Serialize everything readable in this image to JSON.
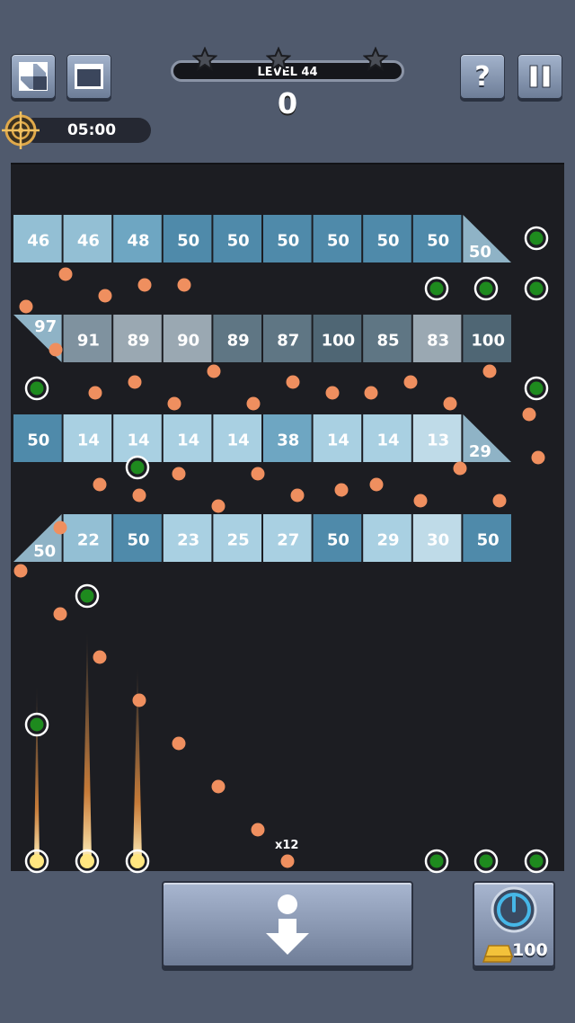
{
  "hud": {
    "level_label": "LEVEL 44",
    "score": "0",
    "timer": "05:00",
    "stars_total": 3,
    "stars_earned": 0
  },
  "buttons": {
    "help_label": "?",
    "pause_label": "II",
    "power_cost": "100"
  },
  "balls": {
    "multiplier_label": "x12"
  },
  "colors": {
    "background": "#505a6d",
    "board": "#1c1d22",
    "ball": "#ef8f5f",
    "pickup_ring": "#ffffff",
    "pickup_core": "#1e8a1e"
  },
  "bricks": {
    "row1": [
      {
        "value": "46",
        "shade": "light"
      },
      {
        "value": "46",
        "shade": "light"
      },
      {
        "value": "48",
        "shade": "medium"
      },
      {
        "value": "50",
        "shade": "dark"
      },
      {
        "value": "50",
        "shade": "dark"
      },
      {
        "value": "50",
        "shade": "dark"
      },
      {
        "value": "50",
        "shade": "dark"
      },
      {
        "value": "50",
        "shade": "dark"
      },
      {
        "value": "50",
        "shade": "dark"
      },
      {
        "value": "50",
        "shape": "triangle-bottom-left"
      }
    ],
    "row2": [
      {
        "value": "97",
        "shape": "triangle-top-right"
      },
      {
        "value": "91",
        "shade": "grey-medium"
      },
      {
        "value": "89",
        "shade": "grey-light"
      },
      {
        "value": "90",
        "shade": "grey-light"
      },
      {
        "value": "89",
        "shade": "grey-dark"
      },
      {
        "value": "87",
        "shade": "grey-dark"
      },
      {
        "value": "100",
        "shade": "grey-darker"
      },
      {
        "value": "85",
        "shade": "grey-dark"
      },
      {
        "value": "83",
        "shade": "grey-light"
      },
      {
        "value": "100",
        "shade": "grey-darker"
      }
    ],
    "row3": [
      {
        "value": "50",
        "shade": "dark"
      },
      {
        "value": "14",
        "shade": "pale"
      },
      {
        "value": "14",
        "shade": "pale"
      },
      {
        "value": "14",
        "shade": "pale"
      },
      {
        "value": "14",
        "shade": "pale"
      },
      {
        "value": "38",
        "shade": "medium"
      },
      {
        "value": "14",
        "shade": "pale"
      },
      {
        "value": "14",
        "shade": "pale"
      },
      {
        "value": "13",
        "shade": "palest"
      },
      {
        "value": "29",
        "shape": "triangle-bottom-left"
      }
    ],
    "row4": [
      {
        "value": "50",
        "shape": "triangle-bottom-right"
      },
      {
        "value": "22",
        "shade": "light"
      },
      {
        "value": "50",
        "shade": "dark"
      },
      {
        "value": "23",
        "shade": "pale"
      },
      {
        "value": "25",
        "shade": "pale"
      },
      {
        "value": "27",
        "shade": "pale"
      },
      {
        "value": "50",
        "shade": "dark"
      },
      {
        "value": "29",
        "shade": "pale"
      },
      {
        "value": "30",
        "shade": "palest"
      },
      {
        "value": "50",
        "shade": "dark"
      }
    ]
  }
}
